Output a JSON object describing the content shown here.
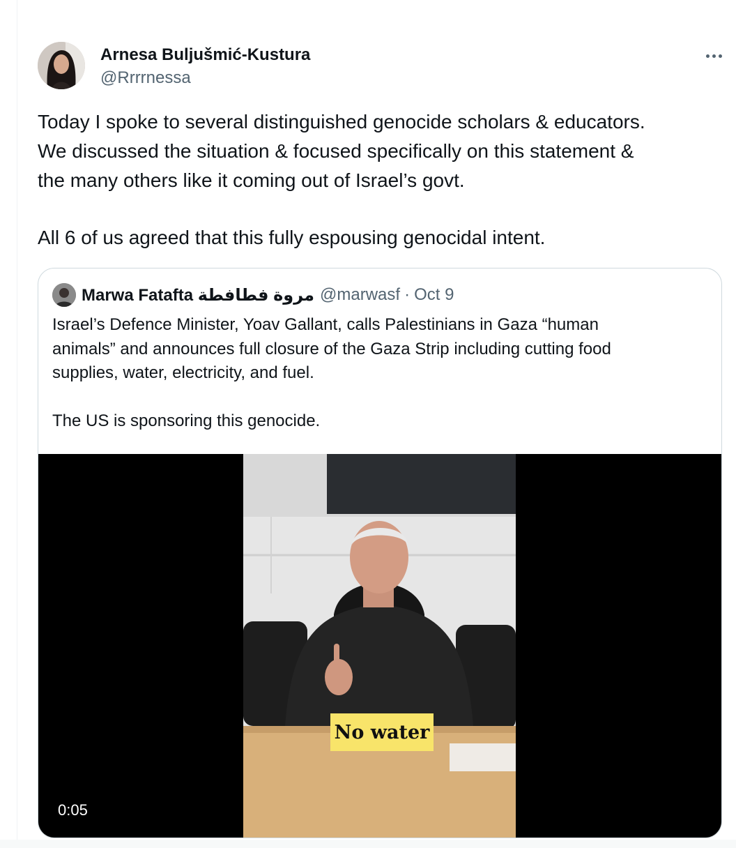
{
  "tweet": {
    "author": {
      "name": "Arnesa Buljušmić-Kustura",
      "handle": "@Rrrrnessa"
    },
    "text": [
      "Today I spoke to several distinguished genocide scholars & educators.",
      "We discussed the situation & focused specifically on this statement &",
      "the many others like it coming out of Israel’s govt.",
      "All 6 of us agreed that this fully espousing genocidal intent."
    ],
    "more_icon": "ellipsis-icon"
  },
  "quote": {
    "author": {
      "name": "Marwa Fatafta مروة فطافطة",
      "handle": "@marwasf",
      "separator": "·",
      "date": "Oct 9"
    },
    "text": [
      "Israel’s Defence Minister, Yoav Gallant, calls Palestinians in Gaza “human",
      "animals” and announces full closure of the Gaza Strip including cutting food",
      "supplies, water, electricity, and fuel.",
      "The US is sponsoring this genocide."
    ],
    "video": {
      "caption": "No water",
      "duration": "0:05"
    }
  },
  "colors": {
    "text": "#0f1419",
    "secondary": "#536471",
    "border": "#cfd9de",
    "caption_bg": "#f8e46a"
  }
}
